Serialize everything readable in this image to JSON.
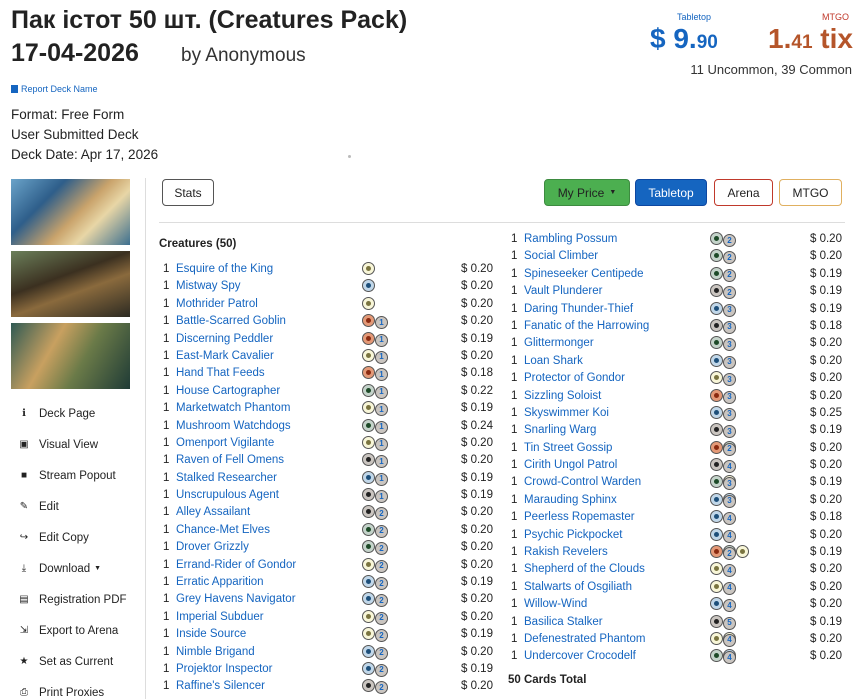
{
  "deck": {
    "title": "Пак істот 50 шт. (Creatures Pack)",
    "date_title": "17-04-2026",
    "byline": "by Anonymous",
    "report_label": "Report Deck Name",
    "format": "Format: Free Form",
    "source": "User Submitted Deck",
    "deck_date": "Deck Date: Apr 17, 2026"
  },
  "prices": {
    "tabletop_label": "Tabletop",
    "mtgo_label": "MTGO",
    "tabletop_main": "$ 9.",
    "tabletop_cents": "90",
    "mtgo_main": "1.",
    "mtgo_cents": "41",
    "mtgo_unit": " tix",
    "rarity": "11 Uncommon, 39 Common"
  },
  "sidebar": {
    "items": [
      {
        "label": "Deck Page",
        "icon": "info-icon",
        "glyph": "ℹ"
      },
      {
        "label": "Visual View",
        "icon": "image-icon",
        "glyph": "▣"
      },
      {
        "label": "Stream Popout",
        "icon": "video-icon",
        "glyph": "■"
      },
      {
        "label": "Edit",
        "icon": "edit-icon",
        "glyph": "✎"
      },
      {
        "label": "Edit Copy",
        "icon": "share-icon",
        "glyph": "↪"
      },
      {
        "label": "Download",
        "icon": "download-icon",
        "glyph": "⤓",
        "caret": true
      },
      {
        "label": "Registration PDF",
        "icon": "document-icon",
        "glyph": "▤"
      },
      {
        "label": "Export to Arena",
        "icon": "export-icon",
        "glyph": "⇲"
      },
      {
        "label": "Set as Current",
        "icon": "star-icon",
        "glyph": "★"
      },
      {
        "label": "Print Proxies",
        "icon": "print-icon",
        "glyph": "⎙"
      }
    ]
  },
  "toolbar": {
    "stats": "Stats",
    "my_price": "My Price",
    "tabletop": "Tabletop",
    "arena": "Arena",
    "mtgo": "MTGO"
  },
  "decklist": {
    "section_title": "Creatures (50)",
    "total": "50 Cards Total",
    "left": [
      {
        "qty": "1",
        "name": "Esquire of the King",
        "cost": [
          "w"
        ],
        "price": "$ 0.20"
      },
      {
        "qty": "1",
        "name": "Mistway Spy",
        "cost": [
          "u"
        ],
        "price": "$ 0.20"
      },
      {
        "qty": "1",
        "name": "Mothrider Patrol",
        "cost": [
          "w"
        ],
        "price": "$ 0.20"
      },
      {
        "qty": "1",
        "name": "Battle-Scarred Goblin",
        "cost": [
          "1",
          "r"
        ],
        "price": "$ 0.20"
      },
      {
        "qty": "1",
        "name": "Discerning Peddler",
        "cost": [
          "1",
          "r"
        ],
        "price": "$ 0.19"
      },
      {
        "qty": "1",
        "name": "East-Mark Cavalier",
        "cost": [
          "1",
          "w"
        ],
        "price": "$ 0.20"
      },
      {
        "qty": "1",
        "name": "Hand That Feeds",
        "cost": [
          "1",
          "r"
        ],
        "price": "$ 0.18"
      },
      {
        "qty": "1",
        "name": "House Cartographer",
        "cost": [
          "1",
          "g"
        ],
        "price": "$ 0.22"
      },
      {
        "qty": "1",
        "name": "Marketwatch Phantom",
        "cost": [
          "1",
          "w"
        ],
        "price": "$ 0.19"
      },
      {
        "qty": "1",
        "name": "Mushroom Watchdogs",
        "cost": [
          "1",
          "g"
        ],
        "price": "$ 0.24"
      },
      {
        "qty": "1",
        "name": "Omenport Vigilante",
        "cost": [
          "1",
          "w"
        ],
        "price": "$ 0.20"
      },
      {
        "qty": "1",
        "name": "Raven of Fell Omens",
        "cost": [
          "1",
          "b"
        ],
        "price": "$ 0.20"
      },
      {
        "qty": "1",
        "name": "Stalked Researcher",
        "cost": [
          "1",
          "u"
        ],
        "price": "$ 0.19"
      },
      {
        "qty": "1",
        "name": "Unscrupulous Agent",
        "cost": [
          "1",
          "b"
        ],
        "price": "$ 0.19"
      },
      {
        "qty": "1",
        "name": "Alley Assailant",
        "cost": [
          "2",
          "b"
        ],
        "price": "$ 0.20"
      },
      {
        "qty": "1",
        "name": "Chance-Met Elves",
        "cost": [
          "2",
          "g"
        ],
        "price": "$ 0.20"
      },
      {
        "qty": "1",
        "name": "Drover Grizzly",
        "cost": [
          "2",
          "g"
        ],
        "price": "$ 0.20"
      },
      {
        "qty": "1",
        "name": "Errand-Rider of Gondor",
        "cost": [
          "2",
          "w"
        ],
        "price": "$ 0.20"
      },
      {
        "qty": "1",
        "name": "Erratic Apparition",
        "cost": [
          "2",
          "u"
        ],
        "price": "$ 0.19"
      },
      {
        "qty": "1",
        "name": "Grey Havens Navigator",
        "cost": [
          "2",
          "u"
        ],
        "price": "$ 0.20"
      },
      {
        "qty": "1",
        "name": "Imperial Subduer",
        "cost": [
          "2",
          "w"
        ],
        "price": "$ 0.20"
      },
      {
        "qty": "1",
        "name": "Inside Source",
        "cost": [
          "2",
          "w"
        ],
        "price": "$ 0.19"
      },
      {
        "qty": "1",
        "name": "Nimble Brigand",
        "cost": [
          "2",
          "u"
        ],
        "price": "$ 0.20"
      },
      {
        "qty": "1",
        "name": "Projektor Inspector",
        "cost": [
          "2",
          "u"
        ],
        "price": "$ 0.19"
      },
      {
        "qty": "1",
        "name": "Raffine's Silencer",
        "cost": [
          "2",
          "b"
        ],
        "price": "$ 0.20"
      }
    ],
    "right": [
      {
        "qty": "1",
        "name": "Rambling Possum",
        "cost": [
          "2",
          "g"
        ],
        "price": "$ 0.20"
      },
      {
        "qty": "1",
        "name": "Social Climber",
        "cost": [
          "2",
          "g"
        ],
        "price": "$ 0.20"
      },
      {
        "qty": "1",
        "name": "Spineseeker Centipede",
        "cost": [
          "2",
          "g"
        ],
        "price": "$ 0.19"
      },
      {
        "qty": "1",
        "name": "Vault Plunderer",
        "cost": [
          "2",
          "b"
        ],
        "price": "$ 0.19"
      },
      {
        "qty": "1",
        "name": "Daring Thunder-Thief",
        "cost": [
          "3",
          "u"
        ],
        "price": "$ 0.19"
      },
      {
        "qty": "1",
        "name": "Fanatic of the Harrowing",
        "cost": [
          "3",
          "b"
        ],
        "price": "$ 0.18"
      },
      {
        "qty": "1",
        "name": "Glittermonger",
        "cost": [
          "3",
          "g"
        ],
        "price": "$ 0.20"
      },
      {
        "qty": "1",
        "name": "Loan Shark",
        "cost": [
          "3",
          "u"
        ],
        "price": "$ 0.20"
      },
      {
        "qty": "1",
        "name": "Protector of Gondor",
        "cost": [
          "3",
          "w"
        ],
        "price": "$ 0.20"
      },
      {
        "qty": "1",
        "name": "Sizzling Soloist",
        "cost": [
          "3",
          "r"
        ],
        "price": "$ 0.20"
      },
      {
        "qty": "1",
        "name": "Skyswimmer Koi",
        "cost": [
          "3",
          "u"
        ],
        "price": "$ 0.25"
      },
      {
        "qty": "1",
        "name": "Snarling Warg",
        "cost": [
          "3",
          "b"
        ],
        "price": "$ 0.19"
      },
      {
        "qty": "1",
        "name": "Tin Street Gossip",
        "cost": [
          "2",
          "r",
          "g"
        ],
        "price": "$ 0.20"
      },
      {
        "qty": "1",
        "name": "Cirith Ungol Patrol",
        "cost": [
          "4",
          "b"
        ],
        "price": "$ 0.20"
      },
      {
        "qty": "1",
        "name": "Crowd-Control Warden",
        "cost": [
          "3",
          "g",
          "w"
        ],
        "price": "$ 0.19"
      },
      {
        "qty": "1",
        "name": "Marauding Sphinx",
        "cost": [
          "3",
          "u",
          "u"
        ],
        "price": "$ 0.20"
      },
      {
        "qty": "1",
        "name": "Peerless Ropemaster",
        "cost": [
          "4",
          "u"
        ],
        "price": "$ 0.18"
      },
      {
        "qty": "1",
        "name": "Psychic Pickpocket",
        "cost": [
          "4",
          "u"
        ],
        "price": "$ 0.20"
      },
      {
        "qty": "1",
        "name": "Rakish Revelers",
        "cost": [
          "2",
          "r",
          "g",
          "w"
        ],
        "price": "$ 0.19"
      },
      {
        "qty": "1",
        "name": "Shepherd of the Clouds",
        "cost": [
          "4",
          "w"
        ],
        "price": "$ 0.20"
      },
      {
        "qty": "1",
        "name": "Stalwarts of Osgiliath",
        "cost": [
          "4",
          "w"
        ],
        "price": "$ 0.20"
      },
      {
        "qty": "1",
        "name": "Willow-Wind",
        "cost": [
          "4",
          "u"
        ],
        "price": "$ 0.20"
      },
      {
        "qty": "1",
        "name": "Basilica Stalker",
        "cost": [
          "5",
          "b"
        ],
        "price": "$ 0.19"
      },
      {
        "qty": "1",
        "name": "Defenestrated Phantom",
        "cost": [
          "4",
          "w",
          "w"
        ],
        "price": "$ 0.20"
      },
      {
        "qty": "1",
        "name": "Undercover Crocodelf",
        "cost": [
          "4",
          "g",
          "u"
        ],
        "price": "$ 0.20"
      }
    ]
  }
}
